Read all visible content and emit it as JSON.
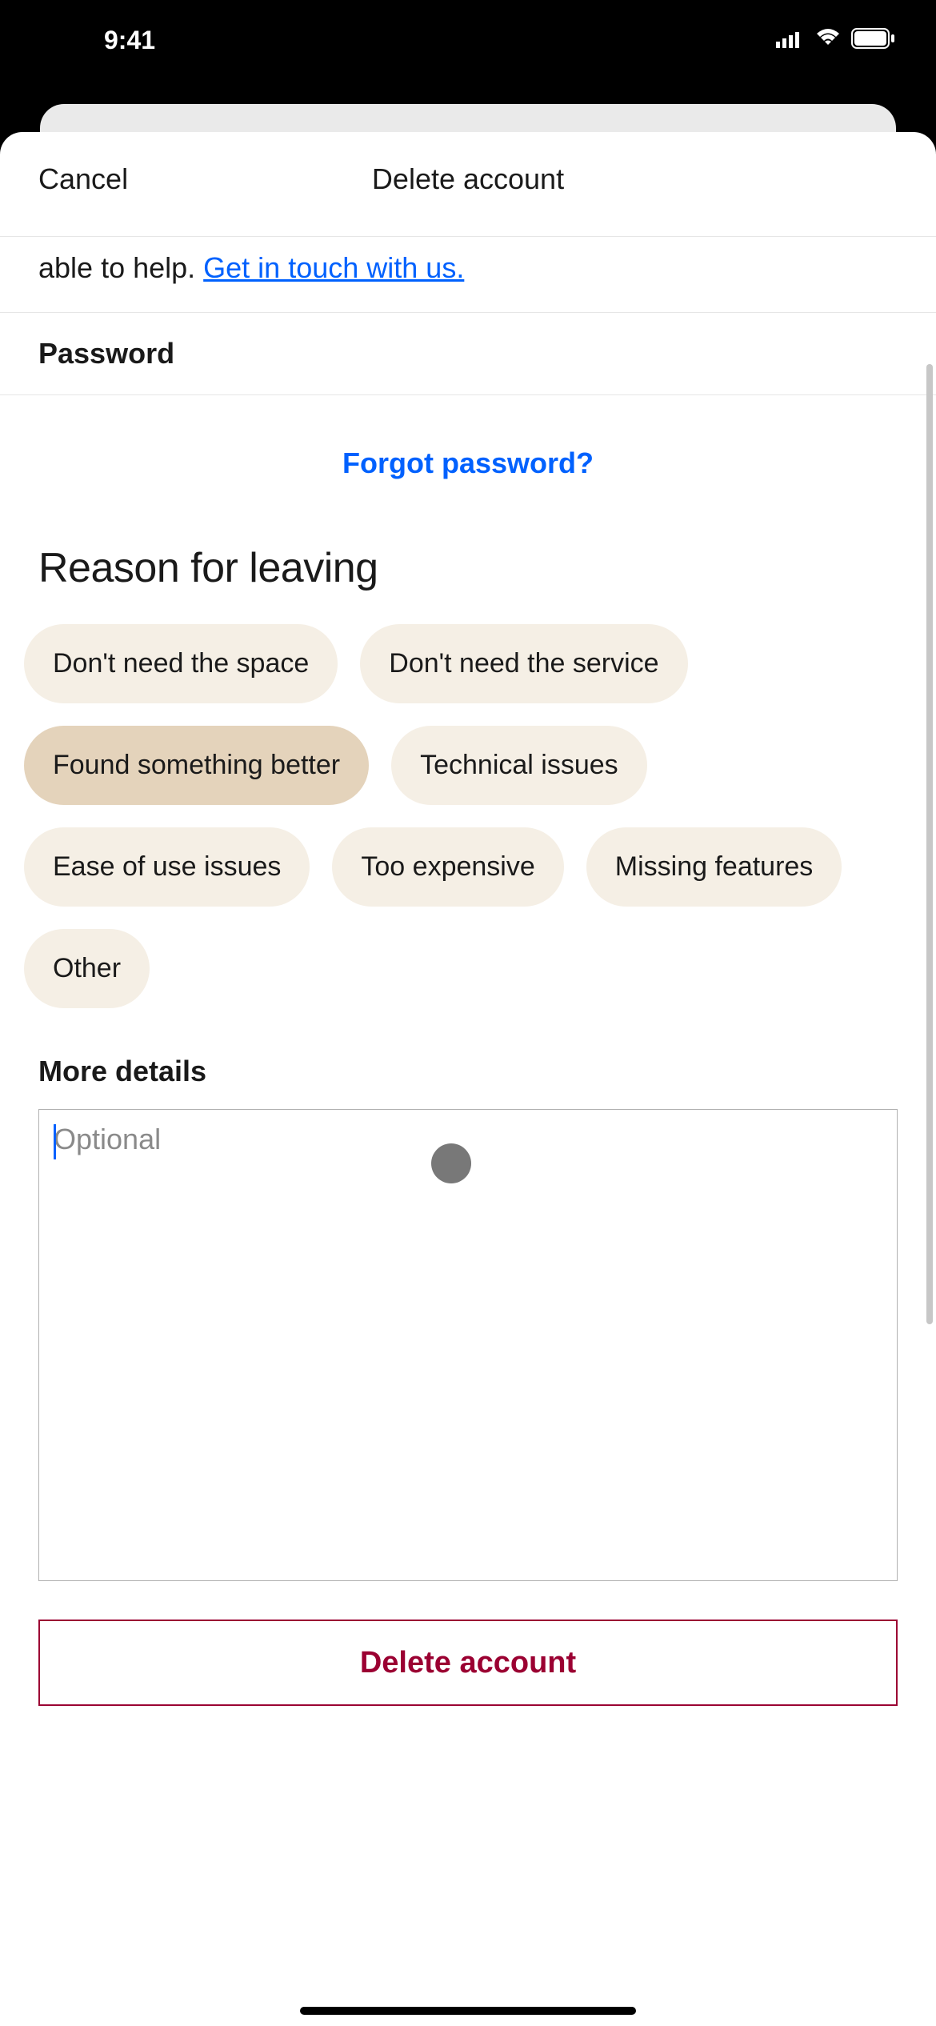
{
  "status": {
    "time": "9:41"
  },
  "modal": {
    "cancel_label": "Cancel",
    "title": "Delete account"
  },
  "help": {
    "prefix": "able to help. ",
    "link_text": "Get in touch with us."
  },
  "password": {
    "label": "Password",
    "forgot_label": "Forgot password?"
  },
  "reason": {
    "heading": "Reason for leaving",
    "chips": [
      {
        "label": "Don't need the space",
        "selected": false
      },
      {
        "label": "Don't need the service",
        "selected": false
      },
      {
        "label": "Found something better",
        "selected": true
      },
      {
        "label": "Technical issues",
        "selected": false
      },
      {
        "label": "Ease of use issues",
        "selected": false
      },
      {
        "label": "Too expensive",
        "selected": false
      },
      {
        "label": "Missing features",
        "selected": false
      },
      {
        "label": "Other",
        "selected": false
      }
    ]
  },
  "more_details": {
    "label": "More details",
    "placeholder": "Optional",
    "value": ""
  },
  "footer": {
    "delete_label": "Delete account"
  }
}
